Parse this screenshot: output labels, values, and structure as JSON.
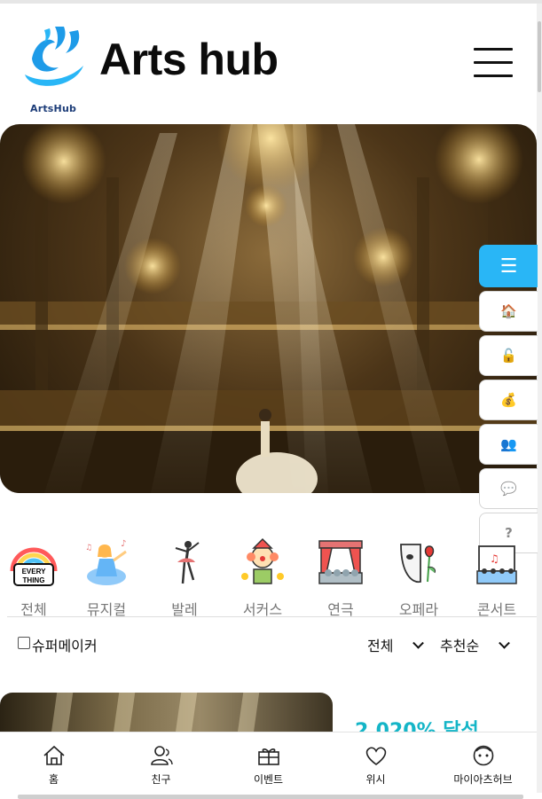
{
  "header": {
    "logo_text": "ArtsHub",
    "title": "Arts hub",
    "menu_icon": "hamburger-icon"
  },
  "hero": {
    "image_alt": ""
  },
  "side_menu": {
    "items": [
      {
        "icon": "menu-icon",
        "glyph": "☰"
      },
      {
        "icon": "home-icon",
        "glyph": "🏠"
      },
      {
        "icon": "unlock-icon",
        "glyph": "🔓"
      },
      {
        "icon": "money-bag-icon",
        "glyph": "💰"
      },
      {
        "icon": "people-icon",
        "glyph": "👥"
      },
      {
        "icon": "chat-icon",
        "glyph": "💬"
      },
      {
        "icon": "help-icon",
        "glyph": "?"
      }
    ]
  },
  "categories": [
    {
      "label": "전체",
      "icon": "everything-rainbow-icon"
    },
    {
      "label": "뮤지컬",
      "icon": "musical-singer-icon"
    },
    {
      "label": "발레",
      "icon": "ballerina-icon"
    },
    {
      "label": "서커스",
      "icon": "clown-icon"
    },
    {
      "label": "연극",
      "icon": "theater-stage-icon"
    },
    {
      "label": "오페라",
      "icon": "opera-mask-icon"
    },
    {
      "label": "콘서트",
      "icon": "concert-stage-icon"
    }
  ],
  "filters": {
    "super_maker_label": "슈퍼메이커",
    "super_maker_checked": false,
    "scope_value": "전체",
    "sort_value": "추천순"
  },
  "card": {
    "achievement": "2,020% 달성"
  },
  "bottom_nav": [
    {
      "label": "홈",
      "icon": "home-icon"
    },
    {
      "label": "친구",
      "icon": "friends-icon"
    },
    {
      "label": "이벤트",
      "icon": "gift-icon"
    },
    {
      "label": "위시",
      "icon": "heart-icon"
    },
    {
      "label": "마이아츠허브",
      "icon": "face-icon"
    }
  ],
  "colors": {
    "accent": "#29b6f6",
    "achievement": "#14b5c7",
    "logo_blue": "#1e9be8"
  }
}
